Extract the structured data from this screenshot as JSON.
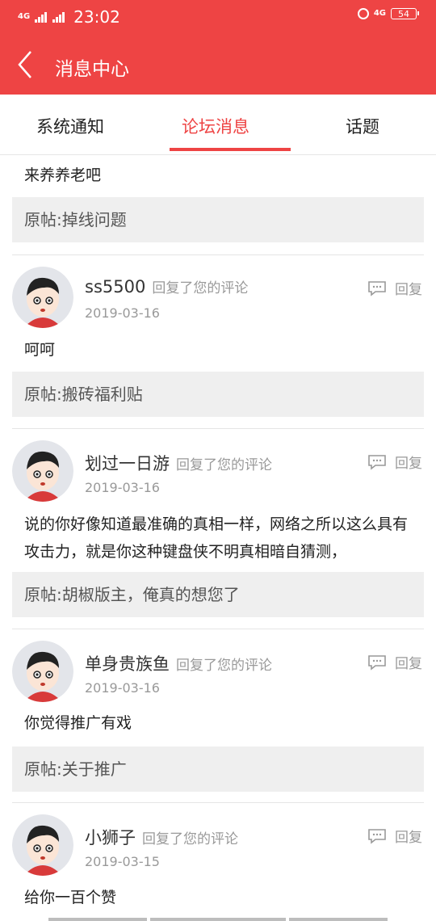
{
  "status_bar": {
    "time": "23:02",
    "signal_left": "4G",
    "signal_right": "4G",
    "battery": "54"
  },
  "header": {
    "title": "消息中心"
  },
  "tabs": [
    {
      "label": "系统通知"
    },
    {
      "label": "论坛消息"
    },
    {
      "label": "话题"
    }
  ],
  "active_tab": 1,
  "top_cut": {
    "text": "来养养老吧",
    "original_post": "原帖:掉线问题"
  },
  "messages": [
    {
      "name": "ss5500",
      "action": "回复了您的评论",
      "date": "2019-03-16",
      "body": "呵呵",
      "original_post": "原帖:搬砖福利贴",
      "reply_label": "回复"
    },
    {
      "name": "划过一日游",
      "action": "回复了您的评论",
      "date": "2019-03-16",
      "body": "说的你好像知道最准确的真相一样，网络之所以这么具有攻击力，就是你这种键盘侠不明真相暗自猜测，",
      "original_post": "原帖:胡椒版主，俺真的想您了",
      "reply_label": "回复"
    },
    {
      "name": "单身贵族鱼",
      "action": "回复了您的评论",
      "date": "2019-03-16",
      "body": "你觉得推广有戏",
      "original_post": "原帖:关于推广",
      "reply_label": "回复"
    },
    {
      "name": "小狮子",
      "action": "回复了您的评论",
      "date": "2019-03-15",
      "body": "给你一百个赞",
      "original_post": "",
      "reply_label": "回复"
    }
  ],
  "colors": {
    "accent": "#ee4444",
    "card_bg": "#efefef"
  }
}
